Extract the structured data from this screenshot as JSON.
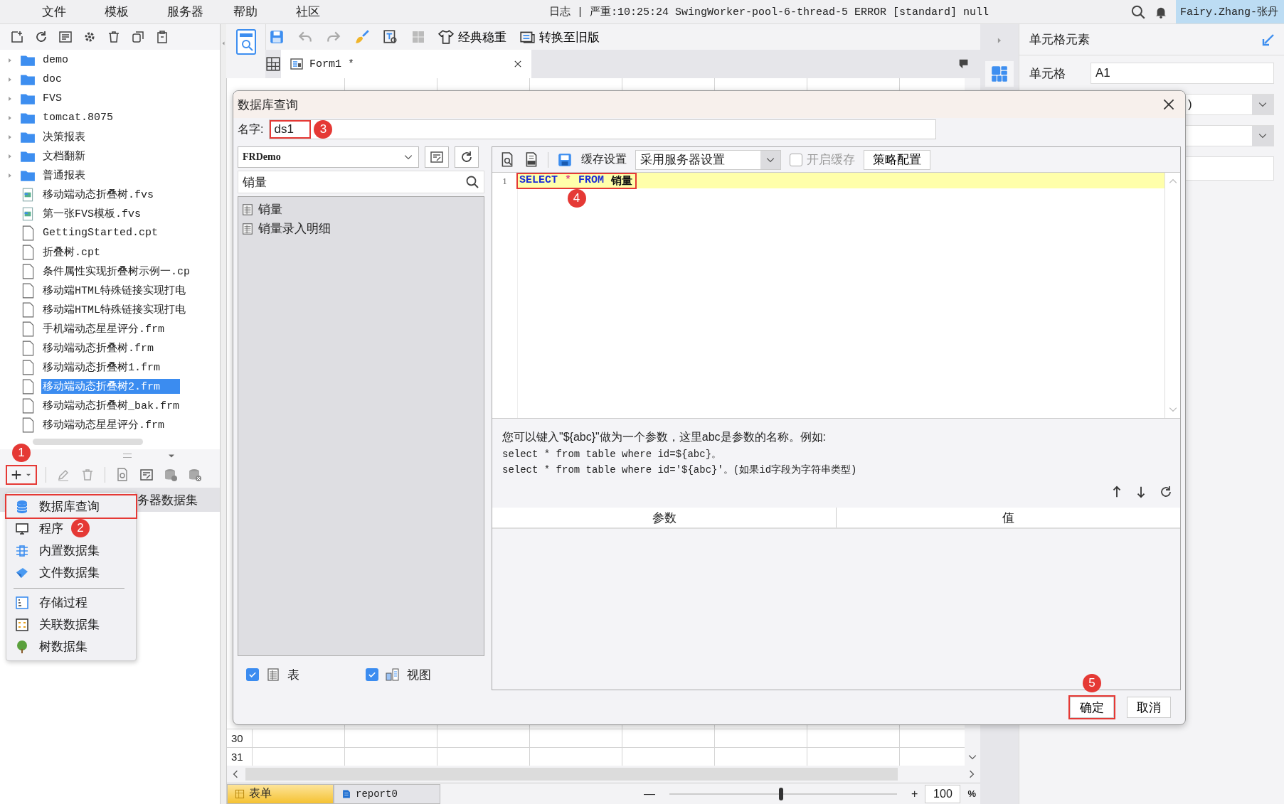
{
  "menu": [
    {
      "label": "文件"
    },
    {
      "label": "模板"
    },
    {
      "label": "服务器"
    },
    {
      "label": "帮助"
    },
    {
      "label": "社区"
    }
  ],
  "log_message": "日志 | 严重:10:25:24 SwingWorker-pool-6-thread-5 ERROR [standard] null",
  "user": "Fairy.Zhang-张丹",
  "file_tree": [
    {
      "label": "demo",
      "kind": "folder",
      "selected": false
    },
    {
      "label": "doc",
      "kind": "folder",
      "selected": false
    },
    {
      "label": "FVS",
      "kind": "folder",
      "selected": false
    },
    {
      "label": "tomcat.8075",
      "kind": "folder",
      "selected": false
    },
    {
      "label": "决策报表",
      "kind": "folder",
      "selected": false
    },
    {
      "label": "文档翻新",
      "kind": "folder",
      "selected": false
    },
    {
      "label": "普通报表",
      "kind": "folder",
      "selected": false
    },
    {
      "label": "移动端动态折叠树.fvs",
      "kind": "fvs",
      "selected": false
    },
    {
      "label": "第一张FVS模板.fvs",
      "kind": "fvs",
      "selected": false
    },
    {
      "label": "GettingStarted.cpt",
      "kind": "file",
      "selected": false
    },
    {
      "label": "折叠树.cpt",
      "kind": "file",
      "selected": false
    },
    {
      "label": "条件属性实现折叠树示例一.cp",
      "kind": "file",
      "selected": false
    },
    {
      "label": "移动端HTML特殊链接实现打电",
      "kind": "file",
      "selected": false
    },
    {
      "label": "移动端HTML特殊链接实现打电",
      "kind": "file",
      "selected": false
    },
    {
      "label": "手机端动态星星评分.frm",
      "kind": "file",
      "selected": false
    },
    {
      "label": "移动端动态折叠树.frm",
      "kind": "file",
      "selected": false
    },
    {
      "label": "移动端动态折叠树1.frm",
      "kind": "file",
      "selected": false
    },
    {
      "label": "移动端动态折叠树2.frm",
      "kind": "file",
      "selected": true
    },
    {
      "label": "移动端动态折叠树_bak.frm",
      "kind": "file",
      "selected": false
    },
    {
      "label": "移动端动态星星评分.frm",
      "kind": "file",
      "selected": false
    }
  ],
  "dataset_panel": {
    "add_button_annotation": {
      "number": "1"
    },
    "row_label": "务器数据集"
  },
  "new_dataset_menu": [
    {
      "items": [
        {
          "label": "数据库查询",
          "kind": "database",
          "annotation": {
            "number": "2"
          }
        },
        {
          "label": "程序",
          "kind": "program"
        },
        {
          "label": "内置数据集",
          "kind": "builtin"
        },
        {
          "label": "文件数据集",
          "kind": "filedata"
        }
      ]
    },
    {
      "items": [
        {
          "label": "存储过程",
          "kind": "procedure"
        },
        {
          "label": "关联数据集",
          "kind": "relation"
        },
        {
          "label": "树数据集",
          "kind": "tree"
        }
      ]
    }
  ],
  "designer_toolbar": {
    "buttons": [
      {
        "label": "经典稳重",
        "kind": "theme"
      },
      {
        "label": "转换至旧版",
        "kind": "convert"
      }
    ]
  },
  "tabs": [
    {
      "label": "Form1 *",
      "selected": true
    }
  ],
  "grid_rows": [
    "30",
    "31"
  ],
  "sheet_tabs": [
    {
      "label": "表单",
      "selected": true
    },
    {
      "label": "report0",
      "selected": false
    }
  ],
  "zoom": {
    "minus": "—",
    "plus": "+",
    "value": "100",
    "unit": "%",
    "level": 0.48
  },
  "property_panel": {
    "title": "单元格元素",
    "cell_label": "单元格",
    "cell_value": "A1",
    "dropdown_value": ")"
  },
  "dialog": {
    "title": "数据库查询",
    "name_label": "名字:",
    "name_value": "ds1",
    "name_annotation": {
      "number": "3"
    },
    "datasource": "FRDemo",
    "search_value": "销量",
    "tables": [
      {
        "label": "销量"
      },
      {
        "label": "销量录入明细"
      }
    ],
    "filters": [
      {
        "label": "表",
        "kind": "table",
        "checked": true
      },
      {
        "label": "视图",
        "kind": "view",
        "checked": true
      }
    ],
    "toolbar": {
      "cache_label": "缓存设置",
      "cache_mode": "采用服务器设置",
      "enable_cache": {
        "label": "开启缓存",
        "checked": false,
        "disabled": true
      },
      "policy_button": "策略配置"
    },
    "sql": {
      "line_number": "1",
      "annotation": {
        "number": "4"
      },
      "tokens": [
        {
          "text": "SELECT",
          "kind": "keyword"
        },
        {
          "text": "*",
          "kind": "operator"
        },
        {
          "text": "FROM",
          "kind": "keyword"
        },
        {
          "text": "销量",
          "kind": "name"
        }
      ]
    },
    "hint": [
      "您可以键入\"${abc}\"做为一个参数，这里abc是参数的名称。例如:",
      "select * from table where id=${abc}。",
      "select * from table where id='${abc}'。(如果id字段为字符串类型)"
    ],
    "param_columns": [
      "参数",
      "值"
    ],
    "buttons": [
      {
        "label": "确定",
        "annotation": {
          "number": "5"
        }
      },
      {
        "label": "取消"
      }
    ]
  }
}
